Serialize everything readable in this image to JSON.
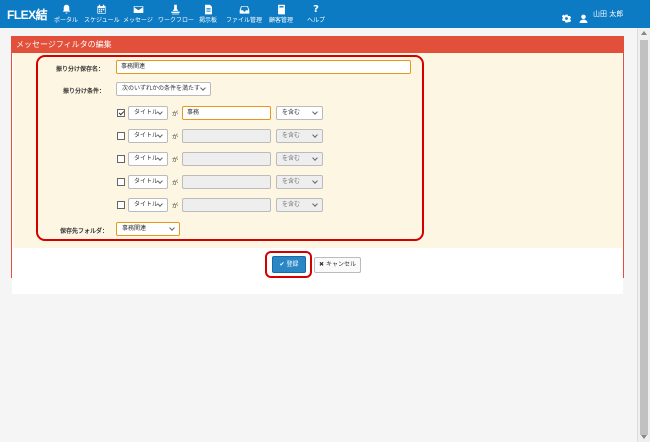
{
  "header": {
    "logo": "FLEX結",
    "nav": [
      {
        "label": "ポータル",
        "icon": "bell-icon"
      },
      {
        "label": "スケジュール",
        "icon": "calendar-icon"
      },
      {
        "label": "メッセージ",
        "icon": "envelope-icon"
      },
      {
        "label": "ワークフロー",
        "icon": "stamp-icon"
      },
      {
        "label": "掲示板",
        "icon": "document-icon"
      },
      {
        "label": "ファイル管理",
        "icon": "inbox-icon"
      },
      {
        "label": "顧客管理",
        "icon": "book-icon"
      },
      {
        "label": "ヘルプ",
        "icon": "question-icon"
      }
    ],
    "user_name": "山田 太郎"
  },
  "panel": {
    "title": "メッセージフィルタの編集"
  },
  "form": {
    "name_label": "振り分け保存名：",
    "name_value": "事務関連",
    "condition_label": "振り分け条件：",
    "condition_value": "次のいずれかの条件を満たす",
    "rows": [
      {
        "checked": true,
        "field": "タイトル",
        "ga": "が",
        "value": "事務",
        "op": "を含む",
        "enabled": true
      },
      {
        "checked": false,
        "field": "タイトル",
        "ga": "が",
        "value": "",
        "op": "を含む",
        "enabled": false
      },
      {
        "checked": false,
        "field": "タイトル",
        "ga": "が",
        "value": "",
        "op": "を含む",
        "enabled": false
      },
      {
        "checked": false,
        "field": "タイトル",
        "ga": "が",
        "value": "",
        "op": "を含む",
        "enabled": false
      },
      {
        "checked": false,
        "field": "タイトル",
        "ga": "が",
        "value": "",
        "op": "を含む",
        "enabled": false
      }
    ],
    "folder_label": "保存先フォルダ：",
    "folder_value": "事務関連"
  },
  "buttons": {
    "save": "登録",
    "cancel": "キャンセル"
  },
  "colors": {
    "topbar": "#0d7bc4",
    "panel_header": "#e2503c",
    "highlight": "#d40000",
    "form_bg": "#fdf6e3"
  }
}
